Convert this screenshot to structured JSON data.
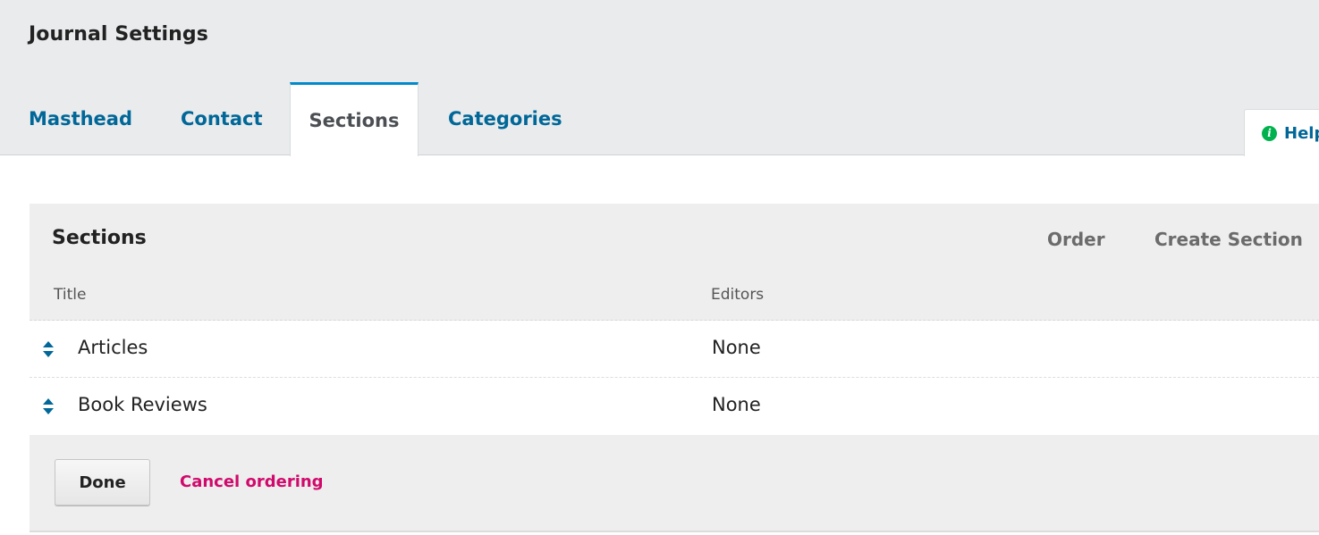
{
  "header": {
    "title": "Journal Settings"
  },
  "tabs": [
    {
      "label": "Masthead",
      "active": false
    },
    {
      "label": "Contact",
      "active": false
    },
    {
      "label": "Sections",
      "active": true
    },
    {
      "label": "Categories",
      "active": false
    }
  ],
  "help": {
    "label": "Help",
    "icon": "info-circle-icon"
  },
  "panel": {
    "title": "Sections",
    "actions": {
      "order": "Order",
      "create": "Create Section"
    },
    "columns": {
      "title": "Title",
      "editors": "Editors"
    },
    "rows": [
      {
        "title": "Articles",
        "editors": "None",
        "icon": "sort-icon"
      },
      {
        "title": "Book Reviews",
        "editors": "None",
        "icon": "sort-icon"
      }
    ],
    "footer": {
      "done": "Done",
      "cancel": "Cancel ordering"
    }
  },
  "colors": {
    "link": "#006798",
    "active_tab_border": "#008acb",
    "cancel": "#d00a6c",
    "help_icon": "#00b24e",
    "header_bg": "#e9ebec",
    "panel_bg": "#eeeeee"
  }
}
